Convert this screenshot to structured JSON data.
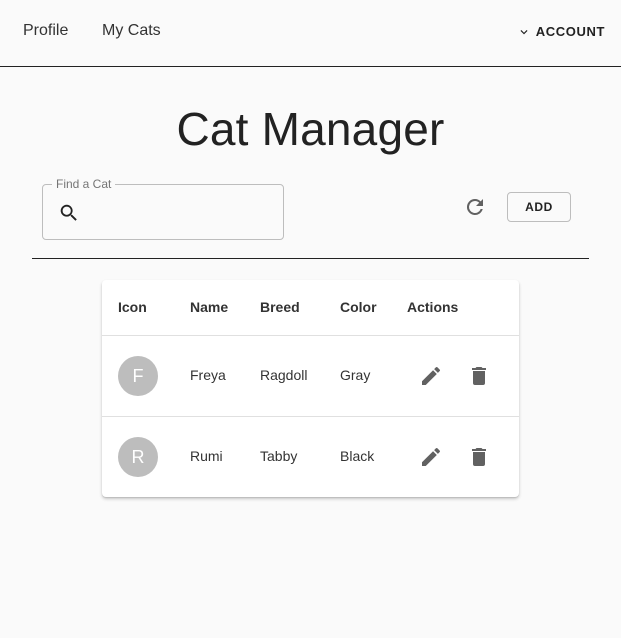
{
  "nav": {
    "links": [
      {
        "label": "Profile"
      },
      {
        "label": "My Cats"
      }
    ],
    "account_label": "ACCOUNT",
    "account_icon": "chevron-down-icon"
  },
  "page": {
    "title": "Cat Manager"
  },
  "search": {
    "label": "Find a Cat",
    "value": "",
    "placeholder": "",
    "icon": "search-icon"
  },
  "toolbar": {
    "refresh_icon": "refresh-icon",
    "add_label": "ADD"
  },
  "table": {
    "headers": [
      "Icon",
      "Name",
      "Breed",
      "Color",
      "Actions"
    ],
    "rows": [
      {
        "initial": "F",
        "name": "Freya",
        "breed": "Ragdoll",
        "color": "Gray"
      },
      {
        "initial": "R",
        "name": "Rumi",
        "breed": "Tabby",
        "color": "Black"
      }
    ],
    "row_actions": [
      "edit-icon",
      "delete-icon"
    ]
  },
  "colors": {
    "background": "#fafafa",
    "avatar": "#bdbdbd",
    "icon": "#616161",
    "text": "#212121"
  }
}
